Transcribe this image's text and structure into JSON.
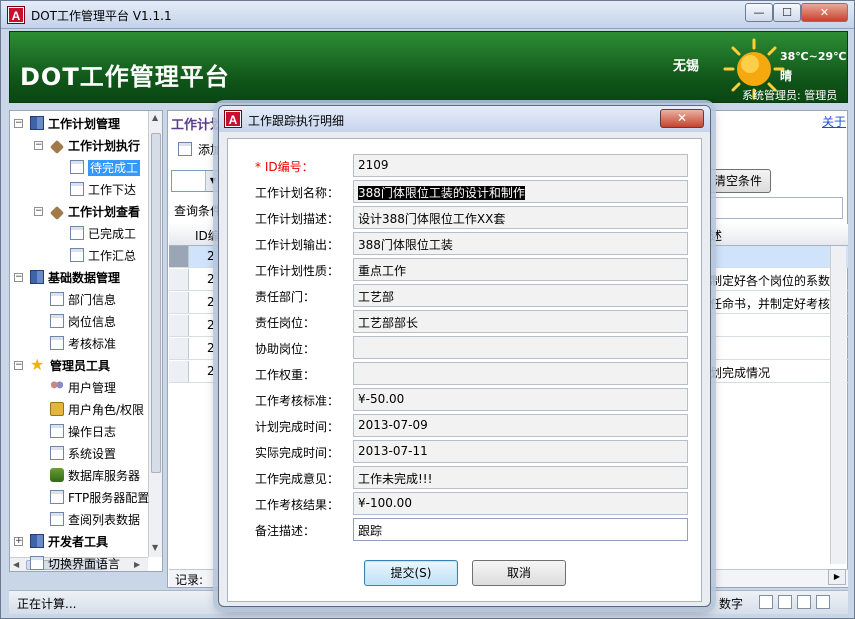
{
  "window": {
    "title": "DOT工作管理平台 V1.1.1",
    "icon_letter": "A",
    "min_glyph": "—",
    "max_glyph": "☐",
    "close_glyph": "✕"
  },
  "banner": {
    "title": "DOT工作管理平台",
    "city": "无锡",
    "temperature": "38℃~29℃",
    "weather": "晴",
    "sys_user": "系统管理员: 管理员"
  },
  "tree": {
    "items": [
      {
        "label": "工作计划管理",
        "level": 0,
        "bold": true,
        "icon": "book-icon",
        "expander": "−"
      },
      {
        "label": "工作计划执行",
        "level": 1,
        "bold": true,
        "icon": "tool-icon",
        "expander": "−"
      },
      {
        "label": "待完成工",
        "level": 2,
        "bold": false,
        "icon": "page-icon",
        "selected": true
      },
      {
        "label": "工作下达",
        "level": 2,
        "bold": false,
        "icon": "page-icon"
      },
      {
        "label": "工作计划查看",
        "level": 1,
        "bold": true,
        "icon": "tool-icon",
        "expander": "−"
      },
      {
        "label": "已完成工",
        "level": 2,
        "bold": false,
        "icon": "page-icon"
      },
      {
        "label": "工作汇总",
        "level": 2,
        "bold": false,
        "icon": "page-icon"
      },
      {
        "label": "基础数据管理",
        "level": 0,
        "bold": true,
        "icon": "book-icon",
        "expander": "−"
      },
      {
        "label": "部门信息",
        "level": 1,
        "bold": false,
        "icon": "page-icon"
      },
      {
        "label": "岗位信息",
        "level": 1,
        "bold": false,
        "icon": "page-icon"
      },
      {
        "label": "考核标准",
        "level": 1,
        "bold": false,
        "icon": "page-icon"
      },
      {
        "label": "管理员工具",
        "level": 0,
        "bold": true,
        "icon": "star-icon",
        "expander": "−"
      },
      {
        "label": "用户管理",
        "level": 1,
        "bold": false,
        "icon": "users-icon"
      },
      {
        "label": "用户角色/权限",
        "level": 1,
        "bold": false,
        "icon": "lock-icon"
      },
      {
        "label": "操作日志",
        "level": 1,
        "bold": false,
        "icon": "page-icon"
      },
      {
        "label": "系统设置",
        "level": 1,
        "bold": false,
        "icon": "page-icon"
      },
      {
        "label": "数据库服务器",
        "level": 1,
        "bold": false,
        "icon": "db-icon"
      },
      {
        "label": "FTP服务器配置",
        "level": 1,
        "bold": false,
        "icon": "page-icon"
      },
      {
        "label": "查阅列表数据",
        "level": 1,
        "bold": false,
        "icon": "page-icon"
      },
      {
        "label": "开发者工具",
        "level": 0,
        "bold": true,
        "icon": "book-icon",
        "expander": "+"
      },
      {
        "label": "切换界面语言",
        "level": 0,
        "bold": false,
        "icon": "page-icon"
      }
    ]
  },
  "main": {
    "tab_title": "工作计划",
    "about_link": "关于",
    "add_button": "添加",
    "clear_button": "清空条件",
    "query_label": "查询条件",
    "grid": {
      "col_id": "ID编",
      "col_desc": "述",
      "rows": [
        {
          "id": "2",
          "desc": ""
        },
        {
          "id": "2",
          "desc": "制定好各个岗位的系数"
        },
        {
          "id": "2",
          "desc": "任命书，并制定好考核"
        },
        {
          "id": "2",
          "desc": ""
        },
        {
          "id": "2",
          "desc": ""
        },
        {
          "id": "2",
          "desc": "划完成情况"
        }
      ]
    },
    "record_label": "记录:"
  },
  "statusbar": {
    "text": "正在计算...",
    "num_label": "数字"
  },
  "dialog": {
    "title": "工作跟踪执行明细",
    "close_glyph": "✕",
    "fields": [
      {
        "label": "* ID编号：",
        "value": "2109",
        "required": true
      },
      {
        "label": "工作计划名称：",
        "value": "388门体限位工装的设计和制作",
        "highlighted": true
      },
      {
        "label": "工作计划描述：",
        "value": "设计388门体限位工作XX套"
      },
      {
        "label": "工作计划输出：",
        "value": "388门体限位工装"
      },
      {
        "label": "工作计划性质：",
        "value": "重点工作"
      },
      {
        "label": "责任部门：",
        "value": "工艺部"
      },
      {
        "label": "责任岗位：",
        "value": "工艺部部长"
      },
      {
        "label": "协助岗位：",
        "value": ""
      },
      {
        "label": "工作权重：",
        "value": ""
      },
      {
        "label": "工作考核标准：",
        "value": "¥-50.00"
      },
      {
        "label": "计划完成时间：",
        "value": "2013-07-09"
      },
      {
        "label": "实际完成时间：",
        "value": "2013-07-11"
      },
      {
        "label": "工作完成意见：",
        "value": "工作未完成!!!"
      },
      {
        "label": "工作考核结果：",
        "value": "¥-100.00"
      },
      {
        "label": "备注描述：",
        "value": "跟踪",
        "editable": true
      }
    ],
    "submit_button": "提交(S)",
    "cancel_button": "取消"
  },
  "colors": {
    "banner_green": "#0f5418",
    "selection_blue": "#3399ff",
    "required_red": "#e00000",
    "title_purple": "#5a3d8a"
  }
}
